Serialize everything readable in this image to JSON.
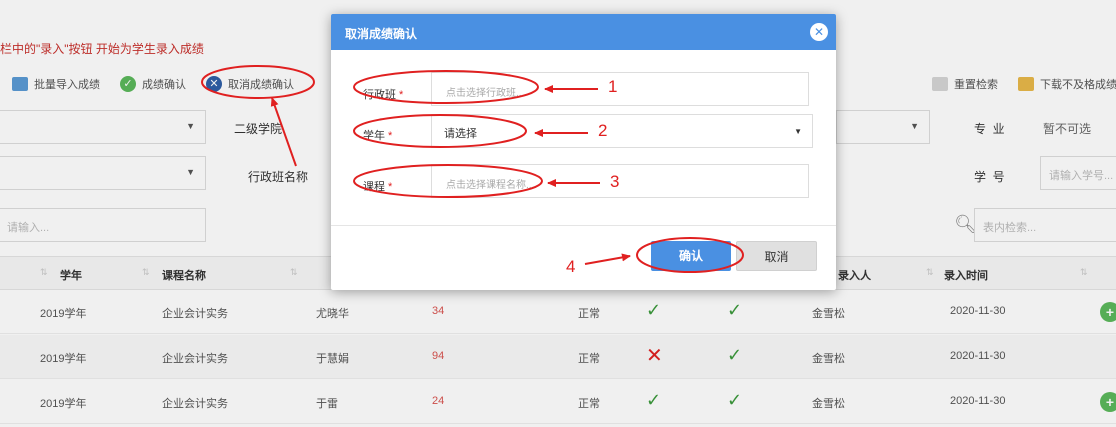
{
  "hint_text": "栏中的\"录入\"按钮 开始为学生录入成绩",
  "toolbar": {
    "import_label": "批量导入成绩",
    "confirm_label": "成绩确认",
    "cancel_confirm_label": "取消成绩确认",
    "reset_label": "重置检索",
    "download_label": "下载不及格成绩"
  },
  "filters": {
    "dept_label": "二级学院",
    "major_label": "专  业",
    "major_value": "暂不可选",
    "class_label": "行政班名称",
    "student_no_label": "学  号",
    "student_no_placeholder": "请输入学号...",
    "left_search_placeholder": "请输入...",
    "table_search_placeholder": "表内检索..."
  },
  "table": {
    "headers": [
      "学年",
      "课程名称",
      "录入人",
      "录入时间"
    ],
    "rows": [
      {
        "year": "2019学年",
        "course": "企业会计实务",
        "teacher": "尤晓华",
        "score": "34",
        "status": "正常",
        "c1": "ok",
        "c2": "ok",
        "recorder": "金雪松",
        "time": "2020-11-30",
        "plus": true
      },
      {
        "year": "2019学年",
        "course": "企业会计实务",
        "teacher": "于慧娟",
        "score": "94",
        "status": "正常",
        "c1": "bad",
        "c2": "ok",
        "recorder": "金雪松",
        "time": "2020-11-30",
        "plus": false
      },
      {
        "year": "2019学年",
        "course": "企业会计实务",
        "teacher": "于雷",
        "score": "24",
        "status": "正常",
        "c1": "ok",
        "c2": "ok",
        "recorder": "金雪松",
        "time": "2020-11-30",
        "plus": true
      }
    ]
  },
  "modal": {
    "title": "取消成绩确认",
    "class_label": "行政班",
    "class_placeholder": "点击选择行政班...",
    "year_label": "学年",
    "year_value": "请选择",
    "course_label": "课程",
    "course_placeholder": "点击选择课程名称...",
    "confirm_label": "确认",
    "cancel_label": "取消"
  },
  "annotations": [
    "1",
    "2",
    "3",
    "4"
  ],
  "colors": {
    "accent": "#4a90e2",
    "annotation_red": "#e02020",
    "success_green": "#3c9a3c"
  }
}
